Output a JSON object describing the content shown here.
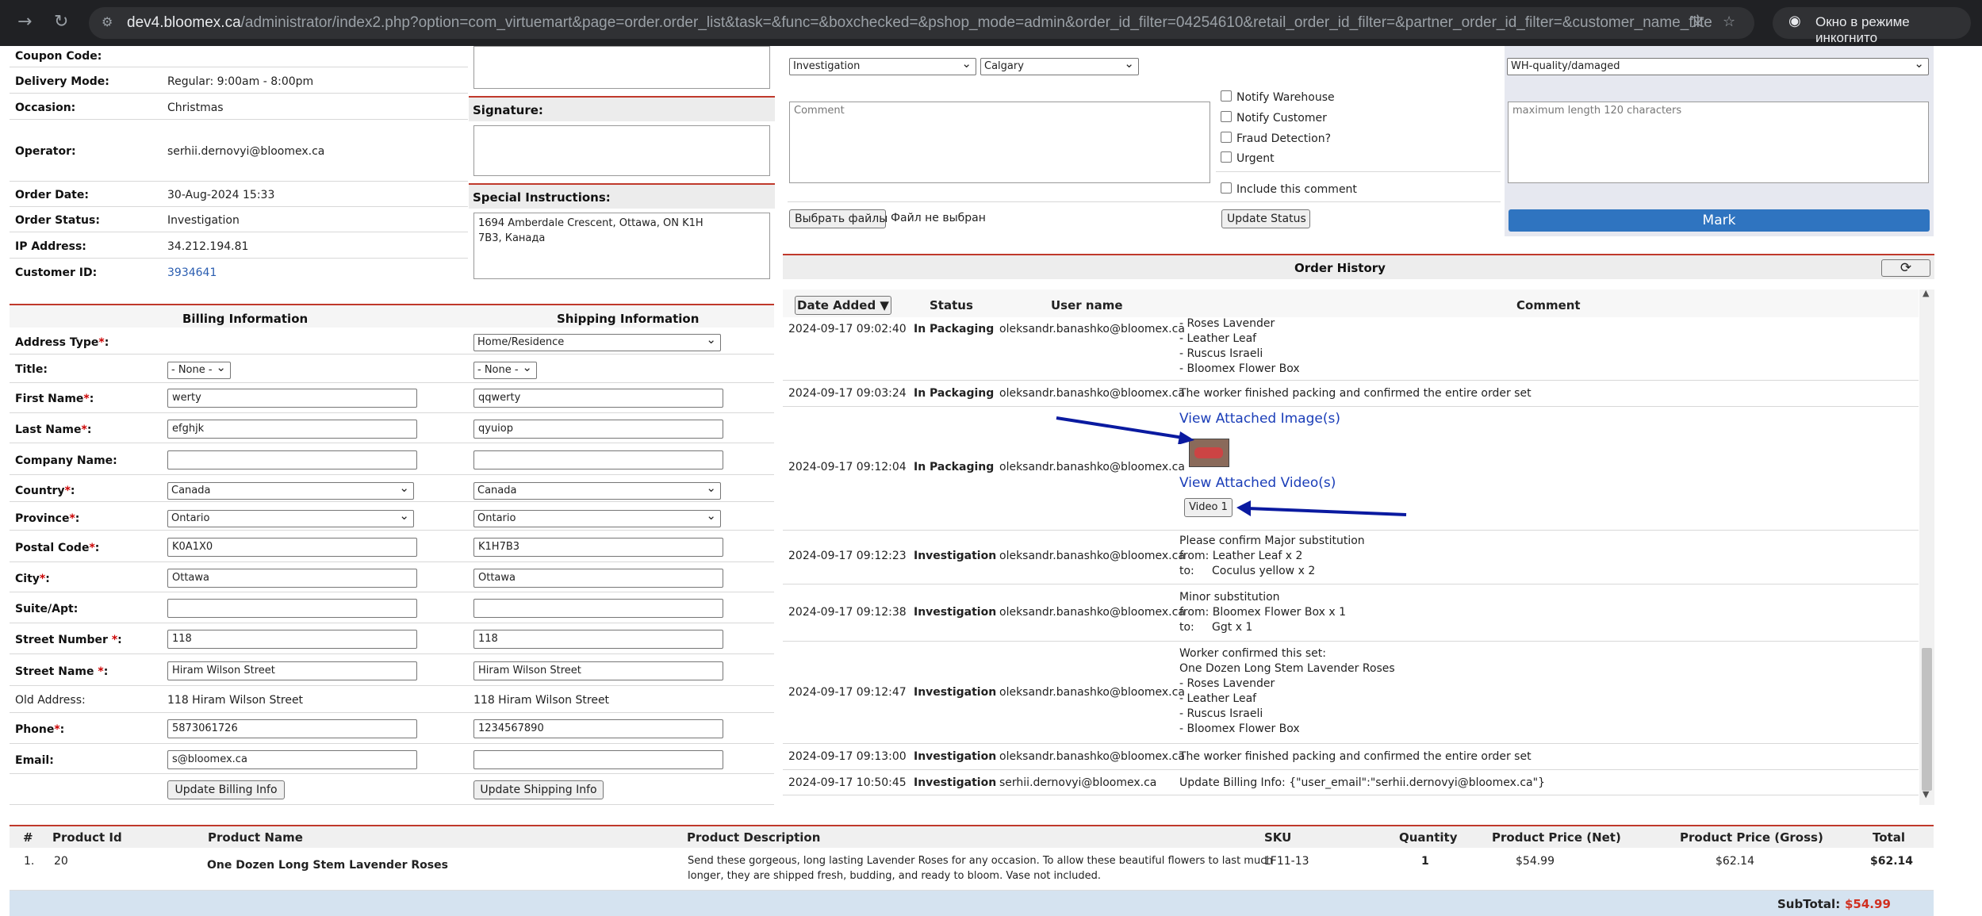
{
  "browser": {
    "url_host": "dev4.bloomex.ca",
    "url_path": "/administrator/index2.php?option=com_virtuemart&page=order.order_list&task=&func=&boxchecked=&pshop_mode=admin&order_id_filter=04254610&retail_order_id_filter=&partner_order_id_filter=&customer_name_filter=&recipi...",
    "incognito_label": "Окно в режиме инкогнито"
  },
  "order_info": {
    "coupon_label": "Coupon Code:",
    "delivery_label": "Delivery Mode:",
    "delivery_value": "Regular: 9:00am - 8:00pm",
    "occasion_label": "Occasion:",
    "occasion_value": "Christmas",
    "operator_label": "Operator:",
    "operator_value": "serhii.dernovyi@bloomex.ca",
    "order_date_label": "Order Date:",
    "order_date_value": "30-Aug-2024 15:33",
    "order_status_label": "Order Status:",
    "order_status_value": "Investigation",
    "ip_label": "IP Address:",
    "ip_value": "34.212.194.81",
    "customer_id_label": "Customer ID:",
    "customer_id_value": "3934641",
    "signature_label": "Signature:",
    "special_label": "Special Instructions:",
    "special_line1": "1694 Amberdale Crescent, Ottawa, ON K1H",
    "special_line2": "7B3, Канада"
  },
  "status_change": {
    "status_select": "Investigation",
    "warehouse_select": "Calgary",
    "comment_placeholder": "Comment",
    "notify_warehouse": "Notify Warehouse",
    "notify_customer": "Notify Customer",
    "fraud_detection": "Fraud Detection?",
    "urgent": "Urgent",
    "include_comment": "Include this comment",
    "choose_files": "Выбрать файлы",
    "no_file": "Файл не выбран",
    "update_status": "Update Status"
  },
  "mark_order": {
    "reason_select": "WH-quality/damaged",
    "placeholder": "maximum length 120 characters",
    "mark_button": "Mark"
  },
  "history": {
    "title": "Order History",
    "col_date": "Date Added ▼",
    "col_status": "Status",
    "col_user": "User name",
    "col_comment": "Comment",
    "top_lines": [
      "- Roses Lavender",
      "- Leather Leaf",
      "- Ruscus Israeli",
      "- Bloomex Flower Box"
    ],
    "r1": {
      "date": "2024-09-17 09:02:40",
      "status": "In Packaging",
      "user": "oleksandr.banashko@bloomex.ca"
    },
    "r2": {
      "date": "2024-09-17 09:03:24",
      "status": "In Packaging",
      "user": "oleksandr.banashko@bloomex.ca",
      "comment": "The worker finished packing and confirmed the entire order set"
    },
    "r3": {
      "date": "2024-09-17 09:12:04",
      "status": "In Packaging",
      "user": "oleksandr.banashko@bloomex.ca",
      "images_link": "View Attached Image(s)",
      "videos_link": "View Attached Video(s)",
      "video_button": "Video 1"
    },
    "r4": {
      "date": "2024-09-17 09:12:23",
      "status": "Investigation",
      "user": "oleksandr.banashko@bloomex.ca",
      "lines": [
        "Please confirm Major substitution",
        "from: Leather Leaf x 2",
        "to:     Coculus yellow x 2"
      ]
    },
    "r5": {
      "date": "2024-09-17 09:12:38",
      "status": "Investigation",
      "user": "oleksandr.banashko@bloomex.ca",
      "lines": [
        "Minor substitution",
        "from: Bloomex Flower Box x 1",
        "to:     Ggt x 1"
      ]
    },
    "r6": {
      "date": "2024-09-17 09:12:47",
      "status": "Investigation",
      "user": "oleksandr.banashko@bloomex.ca",
      "lines": [
        "Worker confirmed this set:",
        "One Dozen Long Stem Lavender Roses",
        "- Roses Lavender",
        "- Leather Leaf",
        "- Ruscus Israeli",
        "- Bloomex Flower Box"
      ]
    },
    "r7": {
      "date": "2024-09-17 09:13:00",
      "status": "Investigation",
      "user": "oleksandr.banashko@bloomex.ca",
      "comment": "The worker finished packing and confirmed the entire order set"
    },
    "r8": {
      "date": "2024-09-17 10:50:45",
      "status": "Investigation",
      "user": "serhii.dernovyi@bloomex.ca",
      "comment": "Update Billing Info: {\"user_email\":\"serhii.dernovyi@bloomex.ca\"}"
    }
  },
  "address": {
    "billing_header": "Billing Information",
    "shipping_header": "Shipping Information",
    "address_type_label": "Address Type",
    "address_type_value": "Home/Residence",
    "title_label": "Title:",
    "title_value": "- None -",
    "first_name_label": "First Name",
    "billing_first": "werty",
    "shipping_first": "qqwerty",
    "last_name_label": "Last Name",
    "billing_last": "efghjk",
    "shipping_last": "qyuiop",
    "company_label": "Company Name:",
    "country_label": "Country",
    "country_value": "Canada",
    "province_label": "Province",
    "province_value": "Ontario",
    "postal_label": "Postal Code",
    "billing_postal": "K0A1X0",
    "shipping_postal": "K1H7B3",
    "city_label": "City",
    "city_value": "Ottawa",
    "suite_label": "Suite/Apt:",
    "street_number_label": "Street Number ",
    "street_number_value": "118",
    "street_name_label": "Street Name ",
    "street_name_value": "Hiram Wilson Street",
    "old_address_label": "Old Address:",
    "old_address_value": "118 Hiram Wilson Street",
    "phone_label": "Phone",
    "billing_phone": "5873061726",
    "shipping_phone": "1234567890",
    "email_label": "Email:",
    "billing_email": "s@bloomex.ca",
    "update_billing": "Update Billing Info",
    "update_shipping": "Update Shipping Info",
    "required_mark": "*",
    "colon": ":"
  },
  "products": {
    "headers": [
      "#",
      "Product Id",
      "Product Name",
      "Product Description",
      "SKU",
      "Quantity",
      "Product Price (Net)",
      "Product Price (Gross)",
      "Total"
    ],
    "row": {
      "num": "1.",
      "id": "20",
      "name": "One Dozen Long Stem Lavender Roses",
      "desc1": "Send these gorgeous, long lasting Lavender Roses for any occasion. To allow these beautiful flowers to last much",
      "desc2": "longer, they are shipped fresh, budding, and ready to bloom. Vase not included.",
      "sku": "LF11-13",
      "qty": "1",
      "net": "$54.99",
      "gross": "$62.14",
      "total": "$62.14"
    },
    "subtotal_label": "SubTotal:",
    "subtotal_value": "$54.99"
  }
}
